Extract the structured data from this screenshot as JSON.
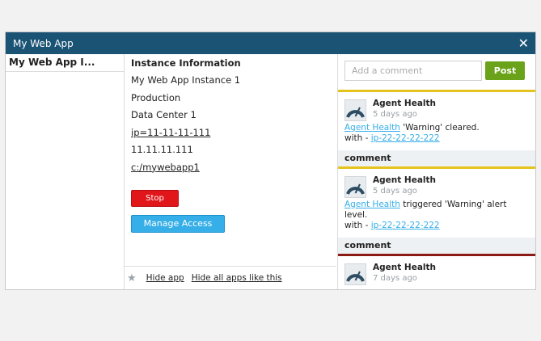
{
  "window": {
    "title": "My Web App",
    "close_glyph": "✕"
  },
  "left": {
    "header": "My Web App I..."
  },
  "info": {
    "heading": "Instance Information",
    "name": "My Web App Instance 1",
    "environment": "Production",
    "datacenter": "Data Center 1",
    "ip_link": "ip=11-11-11-111",
    "ip": "11.11.11.111",
    "path_link": "c:/mywebapp1"
  },
  "actions": {
    "stop": "Stop",
    "manage": "Manage Access"
  },
  "footer": {
    "star": "★",
    "hide_app": "Hide app",
    "hide_all": "Hide all apps like this"
  },
  "comments": {
    "placeholder": "Add a comment",
    "post": "Post",
    "section_label": "comment",
    "feed": [
      {
        "author": "Agent Health",
        "time": "5 days ago",
        "link": "Agent Health",
        "text": " 'Warning' cleared.",
        "with_prefix": "with - ",
        "host": "ip-22-22-22-222"
      },
      {
        "author": "Agent Health",
        "time": "5 days ago",
        "link": "Agent Health",
        "text": " triggered 'Warning' alert level.",
        "with_prefix": "with - ",
        "host": "ip-22-22-22-222"
      },
      {
        "author": "Agent Health",
        "time": "7 days ago"
      }
    ]
  },
  "colors": {
    "titlebar": "#1b5374",
    "stop": "#e0161b",
    "manage": "#36aee8",
    "post": "#6aa31a",
    "warning_accent": "#e6c31c",
    "critical_accent": "#8d1a14"
  }
}
